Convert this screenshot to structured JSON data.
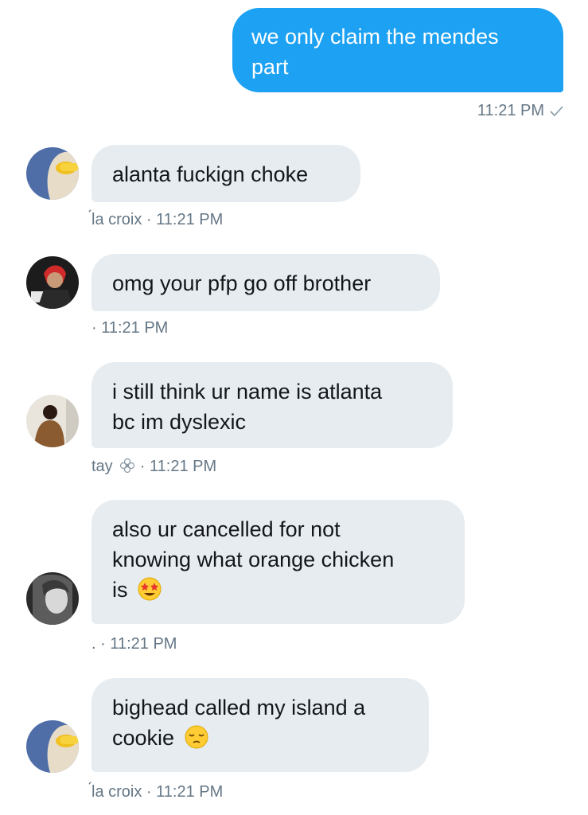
{
  "conversation": {
    "sent": {
      "text_line1": "we only claim the mendes",
      "text_line2": "part",
      "time": "11:21 PM"
    },
    "received": [
      {
        "line1": "alanta fuckign choke",
        "sender": "́la croix",
        "time": "11:21 PM"
      },
      {
        "line1": "omg your pfp go off brother",
        "sender": "",
        "time": "11:21 PM"
      },
      {
        "line1": "i still think ur name is atlanta",
        "line2": "bc im dyslexic",
        "sender": "tay",
        "time": "11:21 PM"
      },
      {
        "line1": "also ur cancelled for not",
        "line2": "knowing what orange chicken",
        "line3": "is",
        "sender": ".",
        "time": "11:21 PM"
      },
      {
        "line1": "bighead called my island a",
        "line2": "cookie",
        "sender": "́la croix",
        "time": "11:21 PM"
      }
    ],
    "separator": " · "
  },
  "icons": {
    "sent_status": "checkmark-icon",
    "star_struck": "star-struck-emoji-icon",
    "pensive": "pensive-emoji-icon",
    "flower": "flower-emoji-icon"
  },
  "colors": {
    "sent_bubble": "#1da1f2",
    "received_bubble": "#e6ecf0",
    "meta_text": "#657786"
  }
}
